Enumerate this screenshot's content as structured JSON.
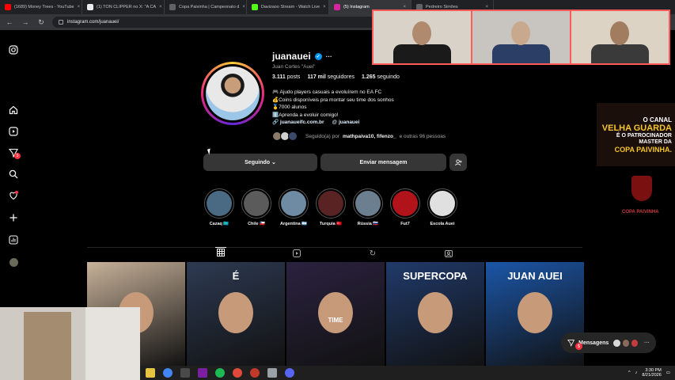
{
  "browser": {
    "tabs": [
      {
        "title": "(1689) Money Trees - YouTube",
        "color": "#ff0000"
      },
      {
        "title": "(1) TON CLIPPER no X: \"A CA",
        "color": "#e8eaed"
      },
      {
        "title": "Copa Paivinha | Campeonato d",
        "color": "#5f6368"
      },
      {
        "title": "Davizaoo Stream - Watch Live",
        "color": "#53fc18"
      },
      {
        "title": "(5) Instagram",
        "color": "#d6249f"
      },
      {
        "title": "Pedreiro Simões",
        "color": "#5f6368"
      }
    ],
    "url": "instagram.com/juanauei/"
  },
  "sidebar": {
    "notifications_badge": "5"
  },
  "profile": {
    "username": "juanauei",
    "full_name": "Juan Cortes \"Auei\"",
    "stats": {
      "posts_value": "3.111",
      "posts_label": "posts",
      "followers_value": "117 mil",
      "followers_label": "seguidores",
      "following_value": "1.265",
      "following_label": "seguindo"
    },
    "bio": [
      "🎮 Ajudo players casuais a evoluírem no EA FC",
      "💰Coins disponíveis pra montar seu time dos sonhos",
      "🥇7000 alunos",
      "ℹ️Aprenda a evoluir comigo!"
    ],
    "link": "juanaueifc.com.br",
    "threads_handle": "juanauei",
    "followed_by_prefix": "Seguido(a) por",
    "followed_by_names": "mathpaiva10, fifenzo_",
    "followed_by_suffix": "e outras 96 pessoas",
    "buttons": {
      "following": "Seguindo ⌄",
      "message": "Enviar mensagem"
    }
  },
  "highlights": [
    {
      "label": "Cazaq 🇰🇿",
      "color": "#4a6a84"
    },
    {
      "label": "Chile 🇨🇱",
      "color": "#5b5b5b"
    },
    {
      "label": "Argentina 🇦🇷",
      "color": "#6f8aa3"
    },
    {
      "label": "Turquia 🇹🇷",
      "color": "#5a2323"
    },
    {
      "label": "Rússia 🇷🇺",
      "color": "#6c7f91"
    },
    {
      "label": "Fut7",
      "color": "#b1131b"
    },
    {
      "label": "Escola Auei",
      "color": "#e0e0e0"
    }
  ],
  "grid": [
    {
      "title": "",
      "subtitle": "",
      "color": "#c7b199"
    },
    {
      "title": "É",
      "subtitle": "",
      "color": "#2d3a52"
    },
    {
      "title": "",
      "subtitle": "TIME",
      "color": "#2b2240"
    },
    {
      "title": "SUPERCOPA",
      "subtitle": "",
      "color": "#203a6a"
    },
    {
      "title": "JUAN AUEI",
      "subtitle": "",
      "color": "#1b56a8"
    }
  ],
  "ad": {
    "line1": "O CANAL",
    "line2": "VELHA GUARDA",
    "line3": "É O PATROCINADOR MASTER DA",
    "line4": "COPA PAIVINHA.",
    "crest_label": "COPA PAIVINHA"
  },
  "messages": {
    "label": "Mensagens",
    "badge": "5"
  },
  "taskbar": {
    "time": "3:30 PM",
    "date": "8/21/2026"
  }
}
